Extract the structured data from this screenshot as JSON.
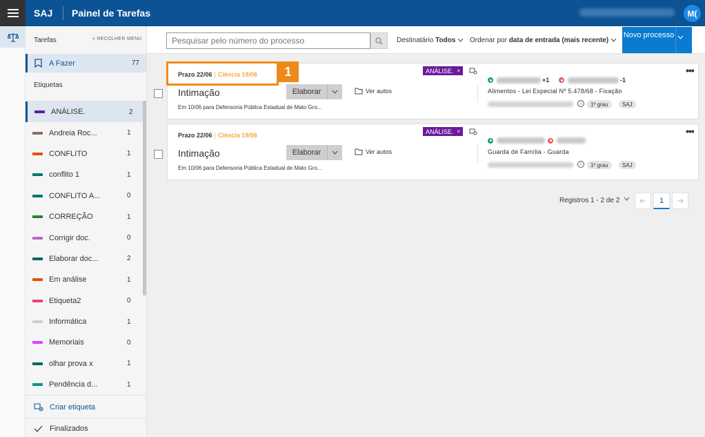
{
  "topbar": {
    "brand": "SAJ",
    "title": "Painel de Tarefas",
    "avatar_initials": "M("
  },
  "sidebar": {
    "header": "Tarefas",
    "collapse_label": "« RECOLHER MENU",
    "afazer": {
      "label": "A Fazer",
      "count": "77"
    },
    "etiquetas_title": "Etiquetas",
    "etiquetas": [
      {
        "name": "ANÁLISE.",
        "count": "2",
        "color": "#6a1b9a",
        "selected": true
      },
      {
        "name": "Andreia Roc...",
        "count": "1",
        "color": "#8d6e63"
      },
      {
        "name": "CONFLITO",
        "count": "1",
        "color": "#e65100"
      },
      {
        "name": "conflito 1",
        "count": "1",
        "color": "#00796b"
      },
      {
        "name": "CONFLITO A...",
        "count": "0",
        "color": "#00796b"
      },
      {
        "name": "CORREÇÃO",
        "count": "1",
        "color": "#2e7d32"
      },
      {
        "name": "Corrigir doc.",
        "count": "0",
        "color": "#ba68c8"
      },
      {
        "name": "Elaborar doc...",
        "count": "2",
        "color": "#00695c"
      },
      {
        "name": "Em análise",
        "count": "1",
        "color": "#e65100"
      },
      {
        "name": "Etiqueta2",
        "count": "0",
        "color": "#ec407a"
      },
      {
        "name": "Informática",
        "count": "1",
        "color": "#cfcfcf"
      },
      {
        "name": "Memoriais",
        "count": "0",
        "color": "#e040fb"
      },
      {
        "name": "olhar prova x",
        "count": "1",
        "color": "#00695c"
      },
      {
        "name": "Pendência d...",
        "count": "1",
        "color": "#009688"
      }
    ],
    "criar_etiqueta": "Criar etiqueta",
    "finalizados": "Finalizados"
  },
  "toolbar": {
    "search_placeholder": "Pesquisar pelo número do processo",
    "destinatario_label": "Destinatário",
    "destinatario_value": "Todos",
    "ordenar_label": "Ordenar por",
    "ordenar_value": "data de entrada (mais recente)",
    "novo_processo": "Novo processo"
  },
  "cards": [
    {
      "prazo": "Prazo 22/06",
      "ciencia": "Ciência 19/06",
      "tipo": "Intimação",
      "elaborar": "Elaborar",
      "ver_autos": "Ver autos",
      "descricao": "Em 10/06 para Defensoria Pública Estadual de Mato Gro...",
      "tag": "ANÁLISE.",
      "ativo_extra": "+1",
      "passivo_extra": "-1",
      "classe": "Alimentos - Lei Especial Nº 5.478/68 - Fixação",
      "grau": "1º grau",
      "sistema": "SAJ"
    },
    {
      "prazo": "Prazo 22/06",
      "ciencia": "Ciência 19/06",
      "tipo": "Intimação",
      "elaborar": "Elaborar",
      "ver_autos": "Ver autos",
      "descricao": "Em 10/06 para Defensoria Pública Estadual de Mato Gro...",
      "tag": "ANÁLISE.",
      "classe": "Guarda de Família - Guarda",
      "grau": "1º grau",
      "sistema": "SAJ"
    }
  ],
  "highlight_number": "1",
  "pagination": {
    "registros": "Registros 1 - 2 de 2",
    "current_page": "1"
  }
}
